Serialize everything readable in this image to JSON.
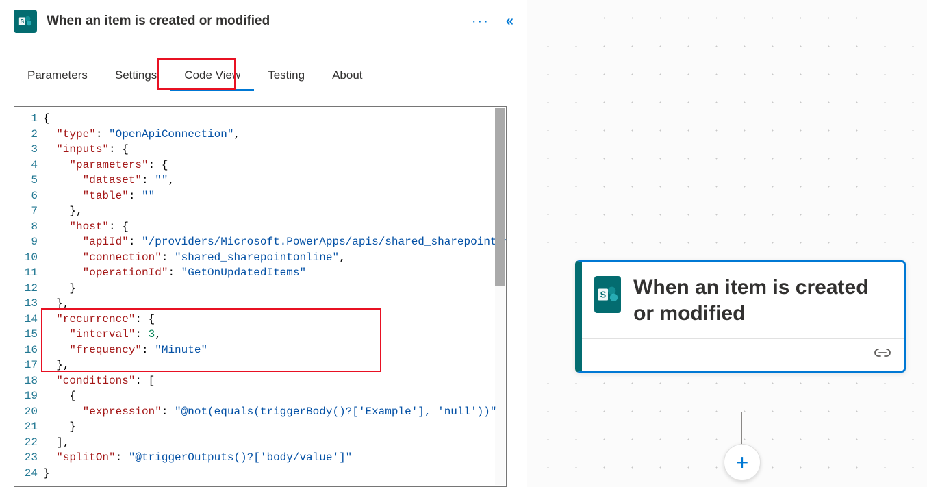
{
  "panel": {
    "title": "When an item is created or modified",
    "icon_name": "sharepoint-icon",
    "more_glyph": "···",
    "collapse_glyph": "«"
  },
  "tabs": [
    {
      "id": "parameters",
      "label": "Parameters",
      "active": false
    },
    {
      "id": "settings",
      "label": "Settings",
      "active": false
    },
    {
      "id": "codeview",
      "label": "Code View",
      "active": true,
      "highlighted": true
    },
    {
      "id": "testing",
      "label": "Testing",
      "active": false
    },
    {
      "id": "about",
      "label": "About",
      "active": false
    }
  ],
  "code": {
    "raw_json": {
      "type": "OpenApiConnection",
      "inputs": {
        "parameters": {
          "dataset": "",
          "table": ""
        },
        "host": {
          "apiId": "/providers/Microsoft.PowerApps/apis/shared_sharepointonl",
          "connection": "shared_sharepointonline",
          "operationId": "GetOnUpdatedItems"
        }
      },
      "recurrence": {
        "interval": 3,
        "frequency": "Minute"
      },
      "conditions": [
        {
          "expression": "@not(equals(triggerBody()?['Example'], 'null'))"
        }
      ],
      "splitOn": "@triggerOutputs()?['body/value']"
    },
    "lines": [
      [
        [
          "brace",
          "{"
        ]
      ],
      [
        [
          "punc",
          "  "
        ],
        [
          "key",
          "\"type\""
        ],
        [
          "punc",
          ": "
        ],
        [
          "str",
          "\"OpenApiConnection\""
        ],
        [
          "punc",
          ","
        ]
      ],
      [
        [
          "punc",
          "  "
        ],
        [
          "key",
          "\"inputs\""
        ],
        [
          "punc",
          ": "
        ],
        [
          "brace",
          "{"
        ]
      ],
      [
        [
          "punc",
          "    "
        ],
        [
          "key",
          "\"parameters\""
        ],
        [
          "punc",
          ": "
        ],
        [
          "brace",
          "{"
        ]
      ],
      [
        [
          "punc",
          "      "
        ],
        [
          "key",
          "\"dataset\""
        ],
        [
          "punc",
          ": "
        ],
        [
          "str",
          "\"\""
        ],
        [
          "punc",
          ","
        ]
      ],
      [
        [
          "punc",
          "      "
        ],
        [
          "key",
          "\"table\""
        ],
        [
          "punc",
          ": "
        ],
        [
          "str",
          "\"\""
        ]
      ],
      [
        [
          "punc",
          "    "
        ],
        [
          "brace",
          "}"
        ],
        [
          "punc",
          ","
        ]
      ],
      [
        [
          "punc",
          "    "
        ],
        [
          "key",
          "\"host\""
        ],
        [
          "punc",
          ": "
        ],
        [
          "brace",
          "{"
        ]
      ],
      [
        [
          "punc",
          "      "
        ],
        [
          "key",
          "\"apiId\""
        ],
        [
          "punc",
          ": "
        ],
        [
          "str",
          "\"/providers/Microsoft.PowerApps/apis/shared_sharepointonl"
        ]
      ],
      [
        [
          "punc",
          "      "
        ],
        [
          "key",
          "\"connection\""
        ],
        [
          "punc",
          ": "
        ],
        [
          "str",
          "\"shared_sharepointonline\""
        ],
        [
          "punc",
          ","
        ]
      ],
      [
        [
          "punc",
          "      "
        ],
        [
          "key",
          "\"operationId\""
        ],
        [
          "punc",
          ": "
        ],
        [
          "str",
          "\"GetOnUpdatedItems\""
        ]
      ],
      [
        [
          "punc",
          "    "
        ],
        [
          "brace",
          "}"
        ]
      ],
      [
        [
          "punc",
          "  "
        ],
        [
          "brace",
          "}"
        ],
        [
          "punc",
          ","
        ]
      ],
      [
        [
          "punc",
          "  "
        ],
        [
          "key",
          "\"recurrence\""
        ],
        [
          "punc",
          ": "
        ],
        [
          "brace",
          "{"
        ]
      ],
      [
        [
          "punc",
          "    "
        ],
        [
          "key",
          "\"interval\""
        ],
        [
          "punc",
          ": "
        ],
        [
          "num",
          "3"
        ],
        [
          "punc",
          ","
        ]
      ],
      [
        [
          "punc",
          "    "
        ],
        [
          "key",
          "\"frequency\""
        ],
        [
          "punc",
          ": "
        ],
        [
          "str",
          "\"Minute\""
        ]
      ],
      [
        [
          "punc",
          "  "
        ],
        [
          "brace",
          "}"
        ],
        [
          "punc",
          ","
        ]
      ],
      [
        [
          "punc",
          "  "
        ],
        [
          "key",
          "\"conditions\""
        ],
        [
          "punc",
          ": "
        ],
        [
          "brace",
          "["
        ]
      ],
      [
        [
          "punc",
          "    "
        ],
        [
          "brace",
          "{"
        ]
      ],
      [
        [
          "punc",
          "      "
        ],
        [
          "key",
          "\"expression\""
        ],
        [
          "punc",
          ": "
        ],
        [
          "str",
          "\"@not(equals(triggerBody()?['Example'], 'null'))\""
        ]
      ],
      [
        [
          "punc",
          "    "
        ],
        [
          "brace",
          "}"
        ]
      ],
      [
        [
          "punc",
          "  "
        ],
        [
          "brace",
          "]"
        ],
        [
          "punc",
          ","
        ]
      ],
      [
        [
          "punc",
          "  "
        ],
        [
          "key",
          "\"splitOn\""
        ],
        [
          "punc",
          ": "
        ],
        [
          "str",
          "\"@triggerOutputs()?['body/value']\""
        ]
      ],
      [
        [
          "brace",
          "}"
        ]
      ]
    ],
    "highlight_start_line": 14,
    "highlight_end_line": 17
  },
  "canvas": {
    "card": {
      "title": "When an item is created or modified",
      "icon_name": "sharepoint-icon",
      "footer_icon": "link-icon"
    },
    "add_button_glyph": "+"
  }
}
